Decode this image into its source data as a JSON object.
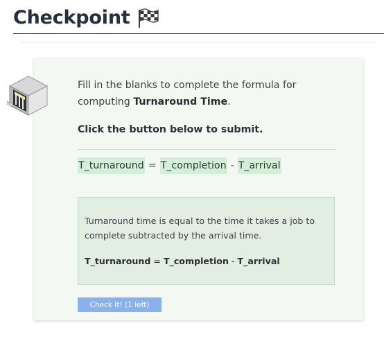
{
  "header": {
    "title": "Checkpoint",
    "flag_icon": "checkered-flag-icon"
  },
  "card": {
    "icon": "server-rack-icon",
    "prompt_prefix": "Fill in the blanks to complete the formula for computing ",
    "prompt_bold": "Turnaround Time",
    "prompt_suffix": ".",
    "instruction": "Click the button below to submit.",
    "formula": {
      "blank1": "T_turnaround",
      "op1": "=",
      "blank2": "T_completion",
      "op2": "-",
      "blank3": "T_arrival"
    },
    "answer": {
      "explanation": "Turnaround time is equal to the time it takes a job to complete subtracted by the arrival time.",
      "term1": "T_turnaround",
      "op1": "=",
      "term2": "T_completion",
      "op2": "-",
      "term3": "T_arrival"
    },
    "check_button_label": "Check It! (1 left)"
  },
  "colors": {
    "blank_highlight": "#d4efd7",
    "card_background": "#f3f8f2",
    "answer_box_background": "#e3eee2",
    "button": "#8ab1ec"
  }
}
